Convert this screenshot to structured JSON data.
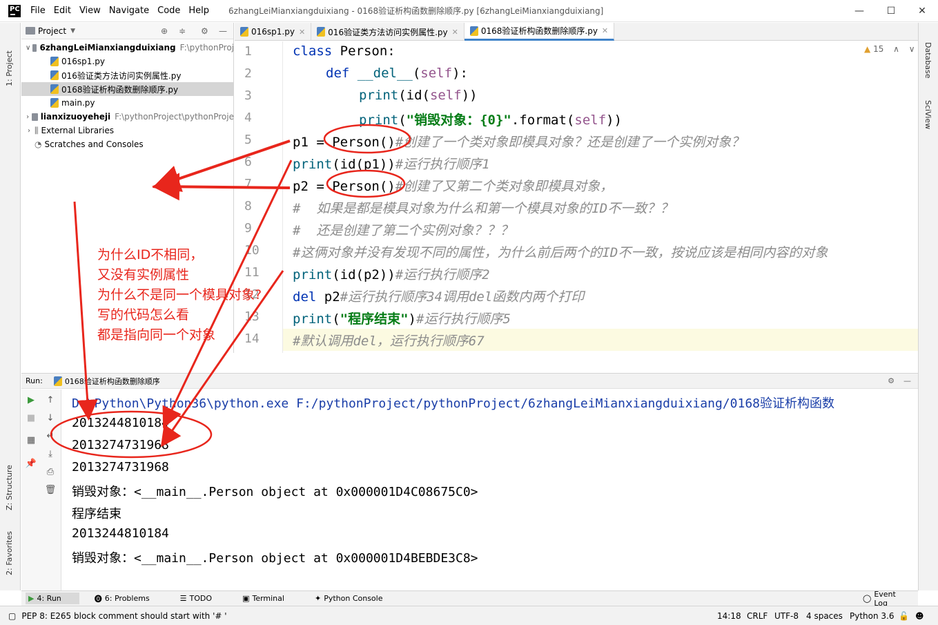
{
  "window": {
    "title": "6zhangLeiMianxiangduixiang - 0168验证析构函数删除顺序.py [6zhangLeiMianxiangduixiang]",
    "app_logo": "PC",
    "minimize": "—",
    "maximize": "☐",
    "close": "✕"
  },
  "menu": [
    "File",
    "Edit",
    "View",
    "Navigate",
    "Code",
    "Help"
  ],
  "side_tabs": {
    "project": "1: Project",
    "structure": "Z: Structure",
    "favorites": "2: Favorites",
    "database": "Database",
    "sciview": "SciView"
  },
  "project": {
    "header": "Project",
    "items": [
      {
        "label": "6zhangLeiMianxiangduixiang",
        "path": "F:\\pythonProj"
      },
      {
        "label": "016sp1.py"
      },
      {
        "label": "016验证类方法访问实例属性.py"
      },
      {
        "label": "0168验证析构函数删除顺序.py"
      },
      {
        "label": "main.py"
      },
      {
        "label": "lianxizuoyeheji",
        "path": "F:\\pythonProject\\pythonProje"
      },
      {
        "label": "External Libraries"
      },
      {
        "label": "Scratches and Consoles"
      }
    ]
  },
  "editor_tabs": [
    {
      "label": "016sp1.py"
    },
    {
      "label": "016验证类方法访问实例属性.py"
    },
    {
      "label": "0168验证析构函数删除顺序.py"
    }
  ],
  "editor": {
    "warning_count": "15",
    "line_numbers": [
      "1",
      "2",
      "3",
      "4",
      "5",
      "6",
      "7",
      "8",
      "9",
      "10",
      "11",
      "12",
      "13",
      "14"
    ],
    "code": {
      "l1_kw": "class",
      "l1_rest": " Person:",
      "l2_kw": "def",
      "l2_name": " __del__",
      "l2_open": "(",
      "l2_self": "self",
      "l2_close": "):",
      "l3_fn": "print",
      "l3_rest": "(id(",
      "l3_self": "self",
      "l3_end": "))",
      "l4_fn": "print",
      "l4_open": "(",
      "l4_str": "\"销毁对象：{0}\"",
      "l4_fmt": ".format(",
      "l4_self": "self",
      "l4_end": "))",
      "l5_code": "p1 = Person()",
      "l5_cm": "#创建了一个类对象即模具对象？还是创建了一个实例对象？",
      "l6_fn": "print",
      "l6_code": "(id(p1))",
      "l6_cm": "#运行执行顺序1",
      "l7_code": "p2 = Person()",
      "l7_cm": "#创建了又第二个类对象即模具对象，",
      "l8_cm": "#  如果是都是模具对象为什么和第一个模具对象的ID不一致？？",
      "l9_cm": "#  还是创建了第二个实例对象？？？",
      "l10_cm": "#这俩对象并没有发现不同的属性，为什么前后两个的ID不一致，按说应该是相同内容的对象",
      "l11_fn": "print",
      "l11_code": "(id(p2))",
      "l11_cm": "#运行执行顺序2",
      "l12_kw": "del",
      "l12_code": " p2",
      "l12_cm": "#运行执行顺序34调用del函数内两个打印",
      "l13_fn": "print",
      "l13_open": "(",
      "l13_str": "\"程序结束\"",
      "l13_close": ")",
      "l13_cm": "#运行执行顺序5",
      "l14_cm": "#默认调用del，运行执行顺序67"
    }
  },
  "run": {
    "label": "Run:",
    "config": "0168验证析构函数删除顺序",
    "output": [
      "D:\\Python\\Python36\\python.exe F:/pythonProject/pythonProject/6zhangLeiMianxiangduixiang/0168验证析构函数",
      "2013244810184",
      "2013274731968",
      "2013274731968",
      "销毁对象：<__main__.Person object at 0x000001D4C08675C0>",
      "程序结束",
      "2013244810184",
      "销毁对象：<__main__.Person object at 0x000001D4BEBDE3C8>"
    ]
  },
  "tool_tabs": [
    "4: Run",
    "6: Problems",
    "TODO",
    "Terminal",
    "Python Console"
  ],
  "event_log": "Event Log",
  "status": {
    "message": "PEP 8: E265 block comment should start with '# '",
    "position": "14:18",
    "line_sep": "CRLF",
    "encoding": "UTF-8",
    "indent": "4 spaces",
    "interpreter": "Python 3.6"
  },
  "annotation": [
    "为什么ID不相同，",
    "又没有实例属性",
    "为什么不是同一个模具对象?",
    "写的代码怎么看",
    "都是指向同一个对象"
  ],
  "colors": {
    "annotation": "#e8261c",
    "keyword": "#0033b3",
    "comment": "#8c8c8c",
    "string": "#067d17",
    "self": "#94558d"
  }
}
